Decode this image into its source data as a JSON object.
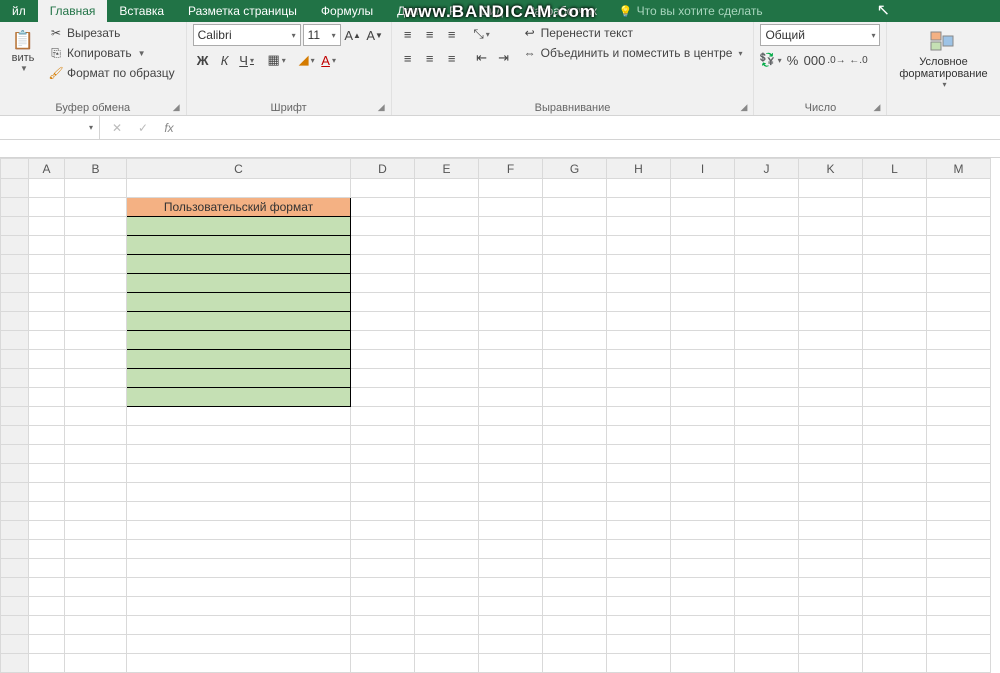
{
  "watermark": "www.BANDICAM.com",
  "tabs": {
    "file": "йл",
    "home": "Главная",
    "insert": "Вставка",
    "layout": "Разметка страницы",
    "formulas": "Формулы",
    "data": "Данн",
    "review": "Р",
    "view": "Вид",
    "dev": "Разработчик",
    "tellme_placeholder": "Что вы хотите сделать"
  },
  "clipboard": {
    "paste": "вить",
    "cut": "Вырезать",
    "copy": "Копировать",
    "format_painter": "Формат по образцу",
    "group": "Буфер обмена"
  },
  "font": {
    "name": "Calibri",
    "size": "11",
    "bold": "Ж",
    "italic": "К",
    "underline": "Ч",
    "group": "Шрифт"
  },
  "alignment": {
    "wrap": "Перенести текст",
    "merge": "Объединить и поместить в центре",
    "group": "Выравнивание"
  },
  "number": {
    "format": "Общий",
    "group": "Число"
  },
  "styles": {
    "cond_fmt": "Условное форматирование"
  },
  "namebox": "",
  "cells": {
    "C2": "Пользовательский формат"
  },
  "columns": [
    "A",
    "B",
    "C",
    "D",
    "E",
    "F",
    "G",
    "H",
    "I",
    "J",
    "K",
    "L",
    "M"
  ]
}
